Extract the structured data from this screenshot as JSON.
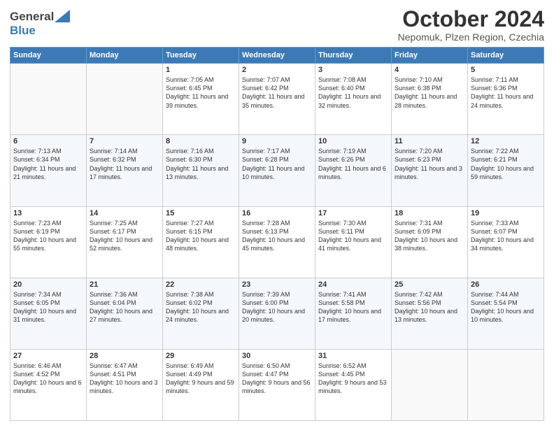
{
  "header": {
    "logo_line1": "General",
    "logo_line2": "Blue",
    "main_title": "October 2024",
    "subtitle": "Nepomuk, Plzen Region, Czechia"
  },
  "days_of_week": [
    "Sunday",
    "Monday",
    "Tuesday",
    "Wednesday",
    "Thursday",
    "Friday",
    "Saturday"
  ],
  "weeks": [
    [
      {
        "day": "",
        "sunrise": "",
        "sunset": "",
        "daylight": ""
      },
      {
        "day": "",
        "sunrise": "",
        "sunset": "",
        "daylight": ""
      },
      {
        "day": "1",
        "sunrise": "Sunrise: 7:05 AM",
        "sunset": "Sunset: 6:45 PM",
        "daylight": "Daylight: 11 hours and 39 minutes."
      },
      {
        "day": "2",
        "sunrise": "Sunrise: 7:07 AM",
        "sunset": "Sunset: 6:42 PM",
        "daylight": "Daylight: 11 hours and 35 minutes."
      },
      {
        "day": "3",
        "sunrise": "Sunrise: 7:08 AM",
        "sunset": "Sunset: 6:40 PM",
        "daylight": "Daylight: 11 hours and 32 minutes."
      },
      {
        "day": "4",
        "sunrise": "Sunrise: 7:10 AM",
        "sunset": "Sunset: 6:38 PM",
        "daylight": "Daylight: 11 hours and 28 minutes."
      },
      {
        "day": "5",
        "sunrise": "Sunrise: 7:11 AM",
        "sunset": "Sunset: 6:36 PM",
        "daylight": "Daylight: 11 hours and 24 minutes."
      }
    ],
    [
      {
        "day": "6",
        "sunrise": "Sunrise: 7:13 AM",
        "sunset": "Sunset: 6:34 PM",
        "daylight": "Daylight: 11 hours and 21 minutes."
      },
      {
        "day": "7",
        "sunrise": "Sunrise: 7:14 AM",
        "sunset": "Sunset: 6:32 PM",
        "daylight": "Daylight: 11 hours and 17 minutes."
      },
      {
        "day": "8",
        "sunrise": "Sunrise: 7:16 AM",
        "sunset": "Sunset: 6:30 PM",
        "daylight": "Daylight: 11 hours and 13 minutes."
      },
      {
        "day": "9",
        "sunrise": "Sunrise: 7:17 AM",
        "sunset": "Sunset: 6:28 PM",
        "daylight": "Daylight: 11 hours and 10 minutes."
      },
      {
        "day": "10",
        "sunrise": "Sunrise: 7:19 AM",
        "sunset": "Sunset: 6:26 PM",
        "daylight": "Daylight: 11 hours and 6 minutes."
      },
      {
        "day": "11",
        "sunrise": "Sunrise: 7:20 AM",
        "sunset": "Sunset: 6:23 PM",
        "daylight": "Daylight: 11 hours and 3 minutes."
      },
      {
        "day": "12",
        "sunrise": "Sunrise: 7:22 AM",
        "sunset": "Sunset: 6:21 PM",
        "daylight": "Daylight: 10 hours and 59 minutes."
      }
    ],
    [
      {
        "day": "13",
        "sunrise": "Sunrise: 7:23 AM",
        "sunset": "Sunset: 6:19 PM",
        "daylight": "Daylight: 10 hours and 55 minutes."
      },
      {
        "day": "14",
        "sunrise": "Sunrise: 7:25 AM",
        "sunset": "Sunset: 6:17 PM",
        "daylight": "Daylight: 10 hours and 52 minutes."
      },
      {
        "day": "15",
        "sunrise": "Sunrise: 7:27 AM",
        "sunset": "Sunset: 6:15 PM",
        "daylight": "Daylight: 10 hours and 48 minutes."
      },
      {
        "day": "16",
        "sunrise": "Sunrise: 7:28 AM",
        "sunset": "Sunset: 6:13 PM",
        "daylight": "Daylight: 10 hours and 45 minutes."
      },
      {
        "day": "17",
        "sunrise": "Sunrise: 7:30 AM",
        "sunset": "Sunset: 6:11 PM",
        "daylight": "Daylight: 10 hours and 41 minutes."
      },
      {
        "day": "18",
        "sunrise": "Sunrise: 7:31 AM",
        "sunset": "Sunset: 6:09 PM",
        "daylight": "Daylight: 10 hours and 38 minutes."
      },
      {
        "day": "19",
        "sunrise": "Sunrise: 7:33 AM",
        "sunset": "Sunset: 6:07 PM",
        "daylight": "Daylight: 10 hours and 34 minutes."
      }
    ],
    [
      {
        "day": "20",
        "sunrise": "Sunrise: 7:34 AM",
        "sunset": "Sunset: 6:05 PM",
        "daylight": "Daylight: 10 hours and 31 minutes."
      },
      {
        "day": "21",
        "sunrise": "Sunrise: 7:36 AM",
        "sunset": "Sunset: 6:04 PM",
        "daylight": "Daylight: 10 hours and 27 minutes."
      },
      {
        "day": "22",
        "sunrise": "Sunrise: 7:38 AM",
        "sunset": "Sunset: 6:02 PM",
        "daylight": "Daylight: 10 hours and 24 minutes."
      },
      {
        "day": "23",
        "sunrise": "Sunrise: 7:39 AM",
        "sunset": "Sunset: 6:00 PM",
        "daylight": "Daylight: 10 hours and 20 minutes."
      },
      {
        "day": "24",
        "sunrise": "Sunrise: 7:41 AM",
        "sunset": "Sunset: 5:58 PM",
        "daylight": "Daylight: 10 hours and 17 minutes."
      },
      {
        "day": "25",
        "sunrise": "Sunrise: 7:42 AM",
        "sunset": "Sunset: 5:56 PM",
        "daylight": "Daylight: 10 hours and 13 minutes."
      },
      {
        "day": "26",
        "sunrise": "Sunrise: 7:44 AM",
        "sunset": "Sunset: 5:54 PM",
        "daylight": "Daylight: 10 hours and 10 minutes."
      }
    ],
    [
      {
        "day": "27",
        "sunrise": "Sunrise: 6:46 AM",
        "sunset": "Sunset: 4:52 PM",
        "daylight": "Daylight: 10 hours and 6 minutes."
      },
      {
        "day": "28",
        "sunrise": "Sunrise: 6:47 AM",
        "sunset": "Sunset: 4:51 PM",
        "daylight": "Daylight: 10 hours and 3 minutes."
      },
      {
        "day": "29",
        "sunrise": "Sunrise: 6:49 AM",
        "sunset": "Sunset: 4:49 PM",
        "daylight": "Daylight: 9 hours and 59 minutes."
      },
      {
        "day": "30",
        "sunrise": "Sunrise: 6:50 AM",
        "sunset": "Sunset: 4:47 PM",
        "daylight": "Daylight: 9 hours and 56 minutes."
      },
      {
        "day": "31",
        "sunrise": "Sunrise: 6:52 AM",
        "sunset": "Sunset: 4:45 PM",
        "daylight": "Daylight: 9 hours and 53 minutes."
      },
      {
        "day": "",
        "sunrise": "",
        "sunset": "",
        "daylight": ""
      },
      {
        "day": "",
        "sunrise": "",
        "sunset": "",
        "daylight": ""
      }
    ]
  ]
}
